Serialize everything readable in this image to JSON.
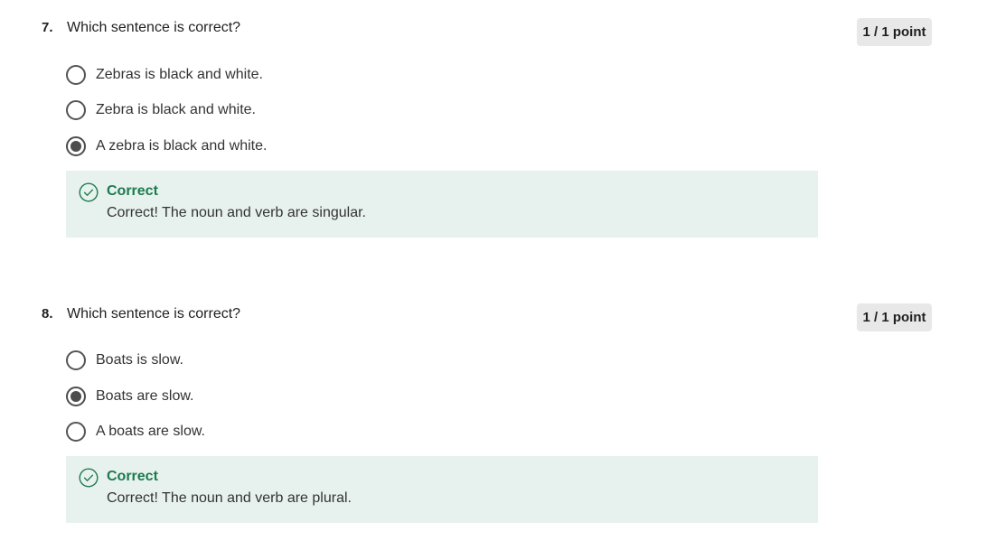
{
  "questions": [
    {
      "number": "7.",
      "text": "Which sentence is correct?",
      "points": "1 / 1 point",
      "options": [
        {
          "label": "Zebras is black and white.",
          "selected": false
        },
        {
          "label": "Zebra is black and white.",
          "selected": false
        },
        {
          "label": "A zebra is black and white.",
          "selected": true
        }
      ],
      "feedback": {
        "icon": "check-circle-icon",
        "title": "Correct",
        "text": "Correct! The noun and verb are singular."
      }
    },
    {
      "number": "8.",
      "text": "Which sentence is correct?",
      "points": "1 / 1 point",
      "options": [
        {
          "label": "Boats is slow.",
          "selected": false
        },
        {
          "label": "Boats are slow.",
          "selected": true
        },
        {
          "label": "A boats are slow.",
          "selected": false
        }
      ],
      "feedback": {
        "icon": "check-circle-icon",
        "title": "Correct",
        "text": "Correct! The noun and verb are plural."
      }
    }
  ],
  "colors": {
    "feedback_background": "#e7f2ee",
    "correct_green": "#1d7a4f",
    "badge_background": "#e8e8e8"
  }
}
